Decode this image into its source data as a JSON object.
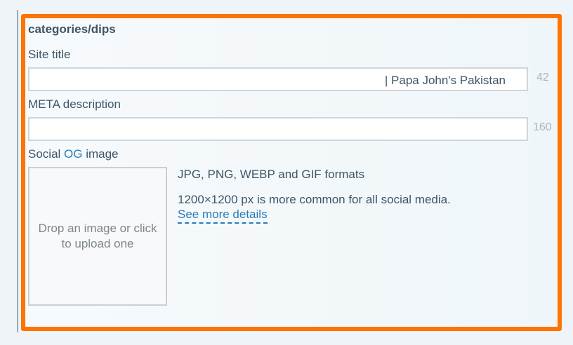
{
  "section": {
    "path_title": "categories/dips"
  },
  "site_title": {
    "label": "Site title",
    "value": "",
    "suffix": "| Papa John's Pakistan",
    "counter": "42"
  },
  "meta_description": {
    "label": "META description",
    "value": "",
    "counter": "160"
  },
  "social_image": {
    "label_prefix": "Social ",
    "label_og": "OG",
    "label_suffix": " image",
    "dropzone_text": "Drop an image or click to upload one",
    "formats_text": "JPG, PNG, WEBP and GIF formats",
    "size_hint": "1200×1200 px is more common for all social media.",
    "details_link": "See more details"
  },
  "colors": {
    "panel_border": "#ff7300",
    "text": "#3d5566",
    "link": "#2b7bb9",
    "counter": "#a9b3b9"
  }
}
